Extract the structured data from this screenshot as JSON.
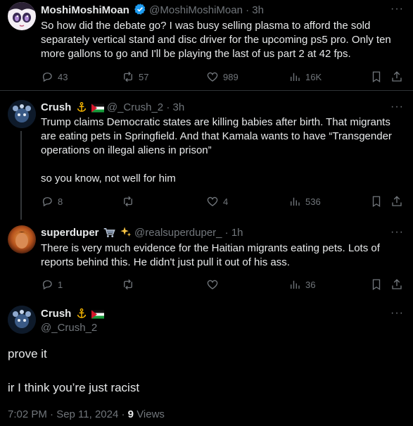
{
  "tweets": [
    {
      "name": "MoshiMoshiMoan",
      "handle": "@MoshiMoshiMoan",
      "sep": "·",
      "time": "3h",
      "lines": [
        "So how did the debate go?  I was busy selling plasma to afford the sold",
        "separately vertical stand and disc driver for the upcoming ps5 pro.  Only ten",
        "more gallons to go and I'll be playing the last of us part 2 at 42 fps."
      ],
      "replies": "43",
      "retweets": "57",
      "likes": "989",
      "views": "16K",
      "verified": true
    },
    {
      "name": "Crush",
      "handle": "@_Crush_2",
      "sep": "·",
      "time": "3h",
      "lines": [
        "Trump claims Democratic states are killing babies after birth. That migrants",
        "are eating pets in Springfield. And that Kamala wants to have “Transgender",
        "operations on illegal aliens in prison”",
        "",
        "so you know, not well for him"
      ],
      "replies": "8",
      "retweets": "",
      "likes": "4",
      "views": "536"
    },
    {
      "name": "superduper",
      "handle": "@realsuperduper_",
      "sep": "·",
      "time": "1h",
      "lines": [
        "There is very much evidence for the Haitian migrants eating pets. Lots of",
        "reports behind this. He didn't just pull it out of his ass."
      ],
      "replies": "1",
      "retweets": "",
      "likes": "",
      "views": "36"
    }
  ],
  "focused": {
    "name": "Crush",
    "handle": "@_Crush_2",
    "line1": "prove it",
    "line2": "ir I think you’re just racist",
    "time": "7:02 PM · Sep 11, 2024 ·",
    "views_count": "9",
    "views_label": "Views"
  },
  "colors": {
    "background": "#000000",
    "text": "#e7e9ea",
    "muted": "#71767b",
    "verified": "#1d9bf0"
  }
}
